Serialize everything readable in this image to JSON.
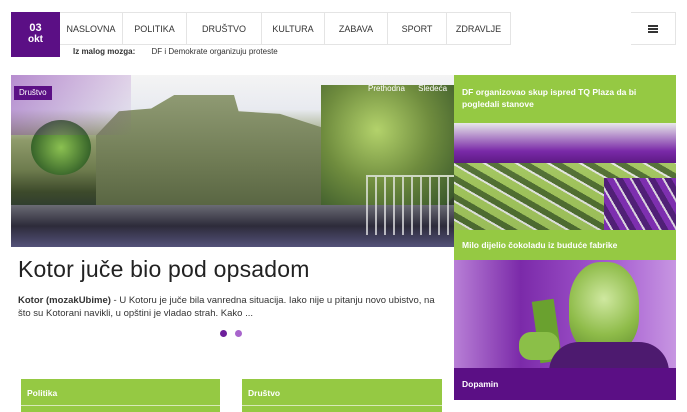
{
  "header": {
    "date_day": "03",
    "date_month": "okt",
    "nav": [
      {
        "label": "NASLOVNA"
      },
      {
        "label": "POLITIKA"
      },
      {
        "label": "DRUŠTVO"
      },
      {
        "label": "KULTURA"
      },
      {
        "label": "ZABAVA"
      },
      {
        "label": "SPORT"
      },
      {
        "label": "ZDRAVLJE"
      }
    ],
    "ticker_label": "Iz malog mozga:",
    "ticker_text": "DF i Demokrate organizuju proteste"
  },
  "slider": {
    "category": "Društvo",
    "prev_label": "Prethodna",
    "next_label": "Sledeća",
    "title": "Kotor juče bio pod opsadom",
    "excerpt_lead": "Kotor (mozakUbime)",
    "excerpt_body": " - U Kotoru je juče bila vanredna situacija. Iako nije u pitanju novo ubistvo, na što su Kotorani navikli, u opštini je vladao strah. Kako ..."
  },
  "sidebar": {
    "items": [
      {
        "title": "DF organizovao skup ispred TQ Plaza da bi pogledali stanove"
      },
      {
        "title": "Milo dijelio čokoladu iz buduće fabrike"
      },
      {
        "title": "Dopamin"
      }
    ]
  },
  "categories": [
    {
      "label": "Politika"
    },
    {
      "label": "Društvo"
    }
  ],
  "colors": {
    "accent_purple": "#5b0f85",
    "accent_green": "#95c943"
  }
}
